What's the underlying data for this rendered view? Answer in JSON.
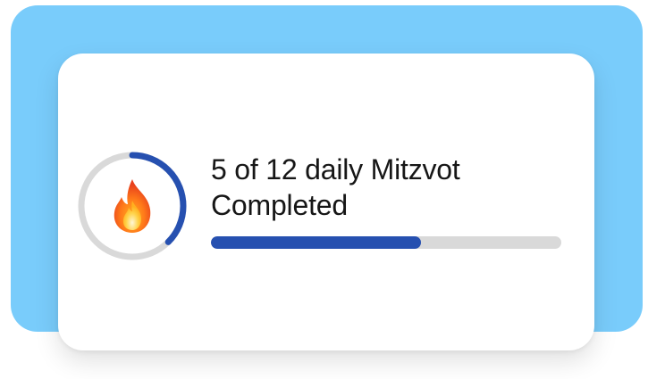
{
  "progress_card": {
    "title_line1": "5 of 12 daily Mitzvot",
    "title_line2": "Completed",
    "completed": 5,
    "total": 12,
    "icon": "fire-icon",
    "ring_fraction": 0.375,
    "bar_fraction": 0.6
  },
  "colors": {
    "backdrop": "#79ccfb",
    "card": "#ffffff",
    "progress": "#2650b0",
    "track": "#d9d9d9",
    "text": "#161616"
  }
}
